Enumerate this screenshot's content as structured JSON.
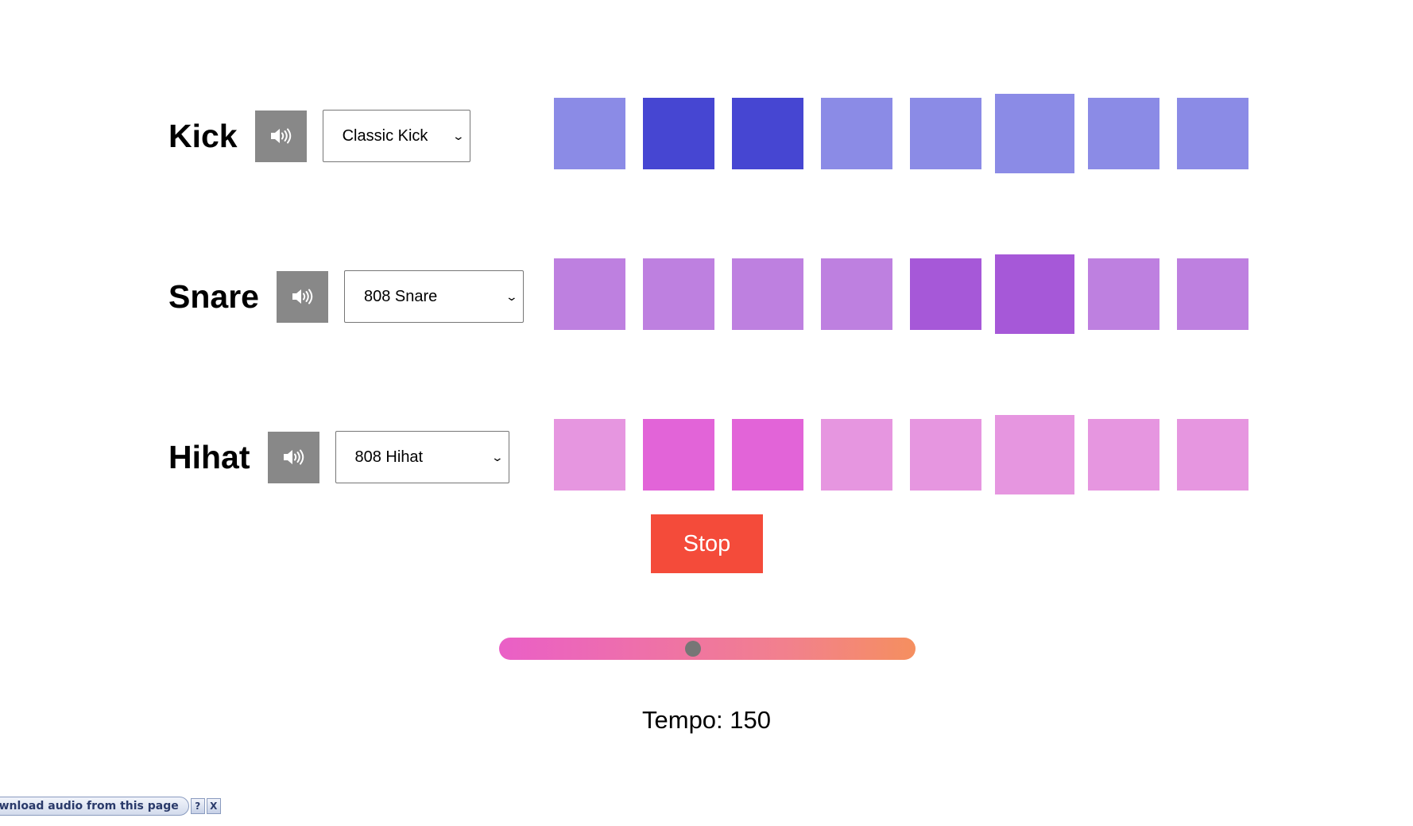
{
  "tracks": [
    {
      "label": "Kick",
      "sound": "Classic Kick",
      "mute_icon": "speaker-icon",
      "color_off": "#8b8be6",
      "color_on": "#4646d2",
      "steps": [
        false,
        true,
        true,
        false,
        false,
        false,
        false,
        false
      ]
    },
    {
      "label": "Snare",
      "sound": "808 Snare",
      "mute_icon": "speaker-icon",
      "color_off": "#be80e0",
      "color_on": "#a658d8",
      "steps": [
        false,
        false,
        false,
        false,
        true,
        true,
        false,
        false
      ]
    },
    {
      "label": "Hihat",
      "sound": "808 Hihat",
      "mute_icon": "speaker-icon",
      "color_off": "#e696e0",
      "color_on": "#e264d8",
      "steps": [
        false,
        true,
        true,
        false,
        false,
        false,
        false,
        false
      ]
    }
  ],
  "current_step": 6,
  "transport": {
    "stop_label": "Stop",
    "stop_color": "#f44b3a"
  },
  "tempo": {
    "value": 150,
    "text": "Tempo: 150",
    "fraction": 0.465
  },
  "download_bar": {
    "text": "ownload audio from this page",
    "help_label": "?",
    "close_label": "X"
  }
}
